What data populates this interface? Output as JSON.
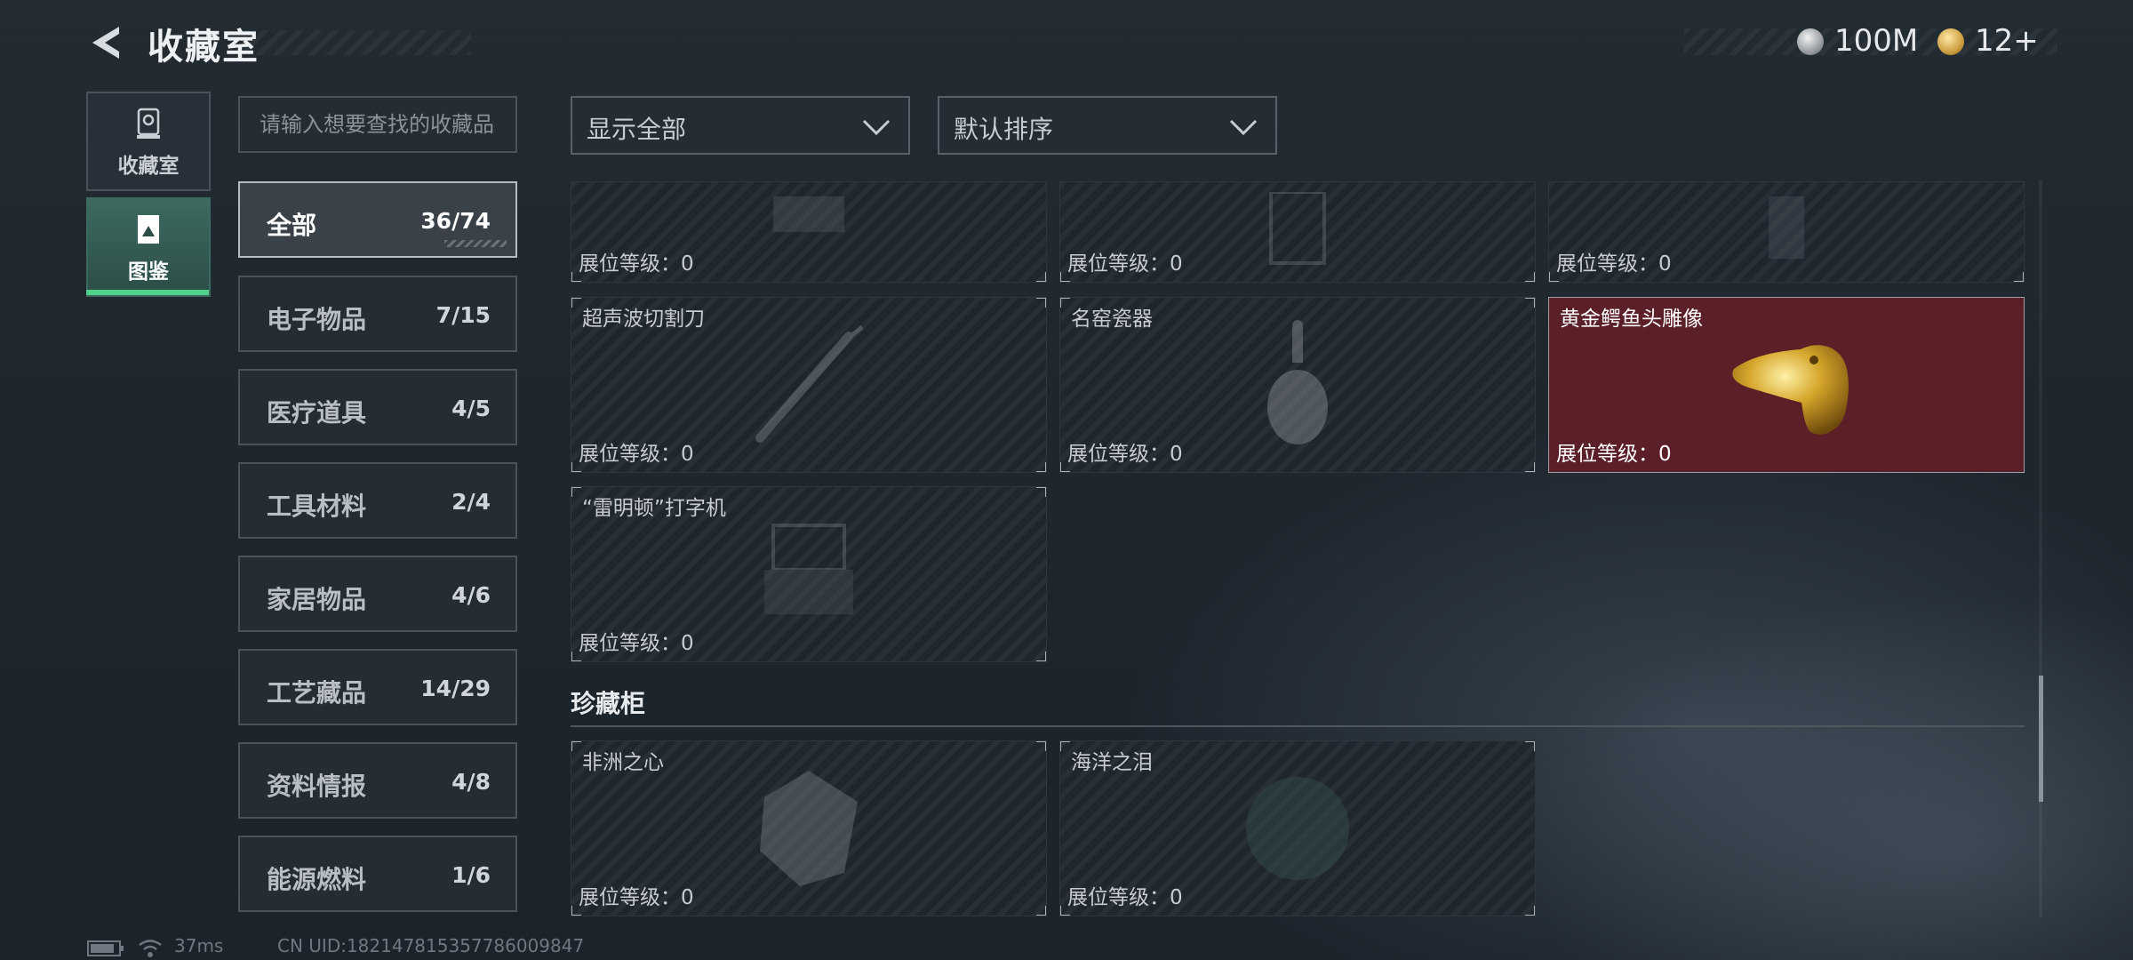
{
  "header": {
    "title": "收藏室",
    "currency1": "100M",
    "currency2": "12+"
  },
  "side_tabs": [
    {
      "label": "收藏室"
    },
    {
      "label": "图鉴"
    }
  ],
  "search": {
    "placeholder": "请输入想要查找的收藏品"
  },
  "categories": [
    {
      "name": "全部",
      "count": "36/74",
      "active": true
    },
    {
      "name": "电子物品",
      "count": "7/15"
    },
    {
      "name": "医疗道具",
      "count": "4/5"
    },
    {
      "name": "工具材料",
      "count": "2/4"
    },
    {
      "name": "家居物品",
      "count": "4/6"
    },
    {
      "name": "工艺藏品",
      "count": "14/29"
    },
    {
      "name": "资料情报",
      "count": "4/8"
    },
    {
      "name": "能源燃料",
      "count": "1/6"
    }
  ],
  "filters": {
    "display": "显示全部",
    "sort": "默认排序"
  },
  "items": [
    {
      "name": "",
      "level": "展位等级：0"
    },
    {
      "name": "",
      "level": "展位等级：0"
    },
    {
      "name": "",
      "level": "展位等级：0"
    },
    {
      "name": "超声波切割刀",
      "level": "展位等级：0"
    },
    {
      "name": "名窑瓷器",
      "level": "展位等级：0"
    },
    {
      "name": "黄金鳄鱼头雕像",
      "level": "展位等级：0",
      "owned": true
    },
    {
      "name": "“雷明顿”打字机",
      "level": "展位等级：0"
    }
  ],
  "cabinet": {
    "title": "珍藏柜",
    "items": [
      {
        "name": "非洲之心",
        "level": "展位等级：0"
      },
      {
        "name": "海洋之泪",
        "level": "展位等级：0"
      }
    ]
  },
  "status": {
    "ping": "37ms",
    "uid": "CN UID:1821478153577860098​47"
  },
  "colors": {
    "accent_green": "#4fd18a",
    "owned_card": "#5b1f28",
    "gold": "#d4a52a"
  },
  "icons": [
    "back-arrow-icon",
    "silver-coin-icon",
    "gold-coin-icon",
    "collection-room-icon",
    "catalog-icon",
    "chevron-down-icon",
    "battery-icon",
    "wifi-icon"
  ]
}
